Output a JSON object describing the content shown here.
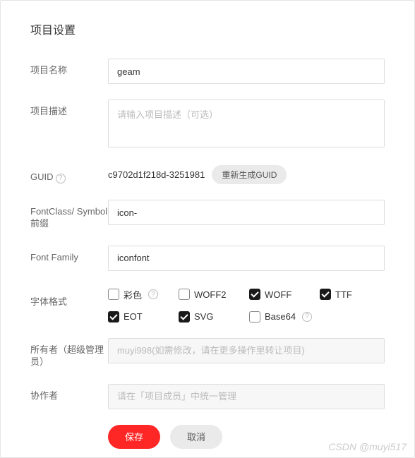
{
  "title": "项目设置",
  "fields": {
    "name": {
      "label": "项目名称",
      "value": "geam"
    },
    "desc": {
      "label": "项目描述",
      "placeholder": "请输入项目描述（可选）"
    },
    "guid": {
      "label": "GUID",
      "value": "c9702d1f218d-3251981",
      "regen": "重新生成GUID"
    },
    "prefix": {
      "label": "FontClass/ Symbol 前缀",
      "value": "icon-"
    },
    "family": {
      "label": "Font Family",
      "value": "iconfont"
    },
    "formats": {
      "label": "字体格式",
      "items": [
        {
          "label": "彩色",
          "checked": false,
          "help": true
        },
        {
          "label": "WOFF2",
          "checked": false,
          "help": false
        },
        {
          "label": "WOFF",
          "checked": true,
          "help": false
        },
        {
          "label": "TTF",
          "checked": true,
          "help": false
        },
        {
          "label": "EOT",
          "checked": true,
          "help": false
        },
        {
          "label": "SVG",
          "checked": true,
          "help": false
        },
        {
          "label": "Base64",
          "checked": false,
          "help": true
        }
      ]
    },
    "owner": {
      "label": "所有者（超级管理员）",
      "placeholder": "muyi998(如需修改，请在更多操作里转让项目)"
    },
    "collab": {
      "label": "协作者",
      "placeholder": "请在「项目成员」中统一管理"
    }
  },
  "actions": {
    "save": "保存",
    "cancel": "取消"
  },
  "watermark": "CSDN @muyi517"
}
